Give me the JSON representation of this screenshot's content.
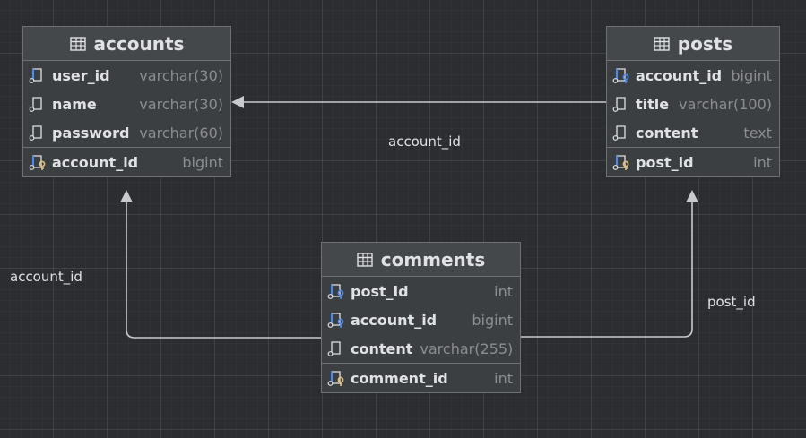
{
  "tables": {
    "accounts": {
      "name": "accounts",
      "columns": [
        {
          "name": "user_id",
          "type": "varchar(30)",
          "icon": "column-indexed-icon"
        },
        {
          "name": "name",
          "type": "varchar(30)",
          "icon": "column-icon"
        },
        {
          "name": "password",
          "type": "varchar(60)",
          "icon": "column-icon"
        },
        {
          "name": "account_id",
          "type": "bigint",
          "icon": "primary-key-icon"
        }
      ]
    },
    "posts": {
      "name": "posts",
      "columns": [
        {
          "name": "account_id",
          "type": "bigint",
          "icon": "foreign-key-icon"
        },
        {
          "name": "title",
          "type": "varchar(100)",
          "icon": "column-icon"
        },
        {
          "name": "content",
          "type": "text",
          "icon": "column-icon"
        },
        {
          "name": "post_id",
          "type": "int",
          "icon": "primary-key-icon"
        }
      ]
    },
    "comments": {
      "name": "comments",
      "columns": [
        {
          "name": "post_id",
          "type": "int",
          "icon": "foreign-key-icon"
        },
        {
          "name": "account_id",
          "type": "bigint",
          "icon": "foreign-key-icon"
        },
        {
          "name": "content",
          "type": "varchar(255)",
          "icon": "column-icon"
        },
        {
          "name": "comment_id",
          "type": "int",
          "icon": "primary-key-icon"
        }
      ]
    }
  },
  "relations": [
    {
      "label": "account_id",
      "from": "posts",
      "to": "accounts"
    },
    {
      "label": "account_id",
      "from": "comments",
      "to": "accounts"
    },
    {
      "label": "post_id",
      "from": "comments",
      "to": "posts"
    }
  ],
  "colors": {
    "background": "#2b2d30",
    "table_bg": "#3c3f41",
    "header_bg": "#45484a",
    "border": "#6e7073",
    "text": "#dfe1e5",
    "type_text": "#8b8d90",
    "edge": "#c8cacd",
    "fk_accent": "#4d8af0",
    "pk_accent": "#e5c07b"
  }
}
